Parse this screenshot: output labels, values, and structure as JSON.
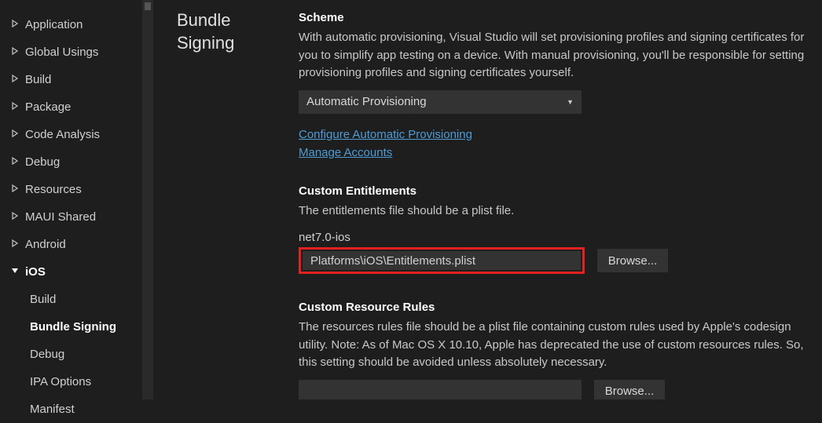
{
  "sidebar": {
    "items": [
      {
        "label": "Application",
        "expanded": false,
        "children": []
      },
      {
        "label": "Global Usings",
        "expanded": false,
        "children": []
      },
      {
        "label": "Build",
        "expanded": false,
        "children": []
      },
      {
        "label": "Package",
        "expanded": false,
        "children": []
      },
      {
        "label": "Code Analysis",
        "expanded": false,
        "children": []
      },
      {
        "label": "Debug",
        "expanded": false,
        "children": []
      },
      {
        "label": "Resources",
        "expanded": false,
        "children": []
      },
      {
        "label": "MAUI Shared",
        "expanded": false,
        "children": []
      },
      {
        "label": "Android",
        "expanded": false,
        "children": []
      },
      {
        "label": "iOS",
        "expanded": true,
        "children": [
          {
            "label": "Build",
            "active": false
          },
          {
            "label": "Bundle Signing",
            "active": true
          },
          {
            "label": "Debug",
            "active": false
          },
          {
            "label": "IPA Options",
            "active": false
          },
          {
            "label": "Manifest",
            "active": false
          }
        ]
      }
    ]
  },
  "section_title_line1": "Bundle",
  "section_title_line2": "Signing",
  "scheme": {
    "heading": "Scheme",
    "desc": "With automatic provisioning, Visual Studio will set provisioning profiles and signing certificates for you to simplify app testing on a device. With manual provisioning, you'll be responsible for setting provisioning profiles and signing certificates yourself.",
    "select_value": "Automatic Provisioning",
    "link1": "Configure Automatic Provisioning",
    "link2": "Manage Accounts"
  },
  "entitlements": {
    "heading": "Custom Entitlements",
    "desc": "The entitlements file should be a plist file.",
    "target_label": "net7.0-ios",
    "value": "Platforms\\iOS\\Entitlements.plist",
    "browse": "Browse..."
  },
  "resource_rules": {
    "heading": "Custom Resource Rules",
    "desc": "The resources rules file should be a plist file containing custom rules used by Apple's codesign utility. Note: As of Mac OS X 10.10, Apple has deprecated the use of custom resources rules. So, this setting should be avoided unless absolutely necessary.",
    "value": "",
    "browse": "Browse..."
  }
}
